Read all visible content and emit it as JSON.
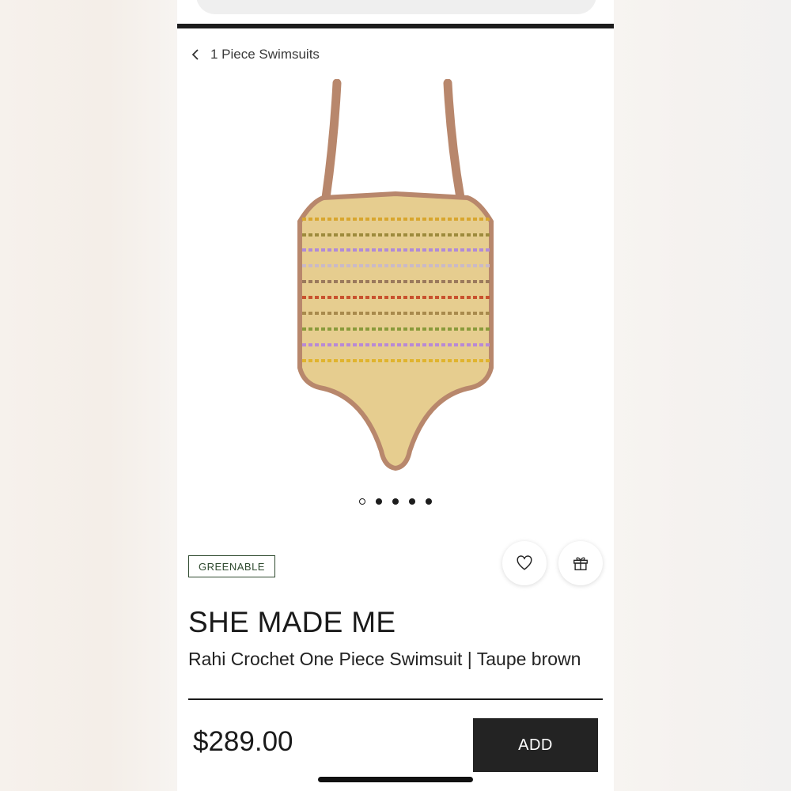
{
  "breadcrumb": {
    "label": "1 Piece Swimsuits",
    "icon": "chevron-left-icon"
  },
  "gallery": {
    "image": "crochet-swimsuit-image",
    "slide_count": 5,
    "active_index": 0
  },
  "badge": {
    "label": "GREENABLE",
    "color": "#2f4a2f"
  },
  "actions": {
    "wishlist_icon": "heart-icon",
    "gift_icon": "gift-icon"
  },
  "product": {
    "brand": "SHE MADE ME",
    "title": "Rahi Crochet One Piece Swimsuit | Taupe brown",
    "price": "$289.00"
  },
  "cart": {
    "add_label": "ADD"
  },
  "colors": {
    "swimsuit_base": "#e6cd8f",
    "swimsuit_trim": "#b8876c",
    "button_bg": "#232323"
  }
}
